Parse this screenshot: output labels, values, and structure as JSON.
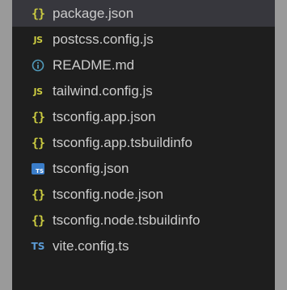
{
  "explorer": {
    "items": [
      {
        "label": "package.json",
        "icon": "json-braces-icon",
        "glyph": "{}"
      },
      {
        "label": "postcss.config.js",
        "icon": "javascript-icon",
        "glyph": "JS"
      },
      {
        "label": "README.md",
        "icon": "info-icon",
        "glyph": ""
      },
      {
        "label": "tailwind.config.js",
        "icon": "javascript-icon",
        "glyph": "JS"
      },
      {
        "label": "tsconfig.app.json",
        "icon": "json-braces-icon",
        "glyph": "{}"
      },
      {
        "label": "tsconfig.app.tsbuildinfo",
        "icon": "json-braces-icon",
        "glyph": "{}"
      },
      {
        "label": "tsconfig.json",
        "icon": "typescript-config-icon",
        "glyph": "TS"
      },
      {
        "label": "tsconfig.node.json",
        "icon": "json-braces-icon",
        "glyph": "{}"
      },
      {
        "label": "tsconfig.node.tsbuildinfo",
        "icon": "json-braces-icon",
        "glyph": "{}"
      },
      {
        "label": "vite.config.ts",
        "icon": "typescript-icon",
        "glyph": "TS"
      }
    ]
  },
  "colors": {
    "background": "#1e1e1e",
    "selected_row": "#37373d",
    "text": "#cccccc",
    "json_icon": "#cbcb41",
    "js_icon": "#cbcb41",
    "info_icon": "#519aba",
    "ts_icon": "#3a7dc9"
  }
}
